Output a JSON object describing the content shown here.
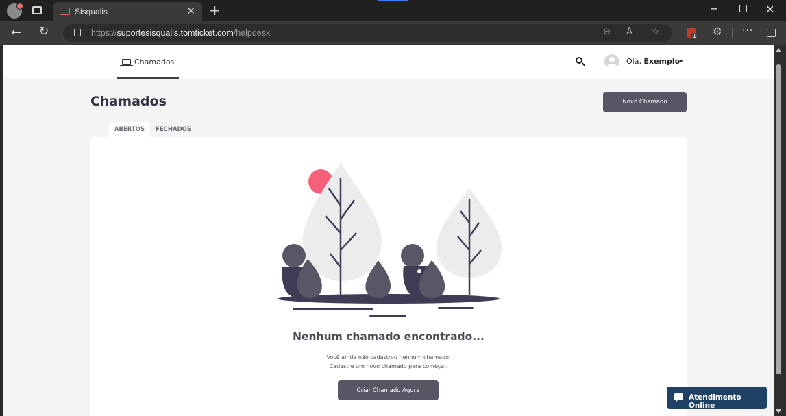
{
  "browser": {
    "tab_title": "Sisqualis",
    "url_prefix": "https://",
    "url_host": "suportesisqualis.tomticket.com",
    "url_path": "/helpdesk",
    "extension_badge_count": "1"
  },
  "header": {
    "nav_tab_label": "Chamados",
    "greeting": "Olá, ",
    "user_name": "Exemplo"
  },
  "page": {
    "title": "Chamados",
    "new_ticket_button": "Novo Chamado",
    "tabs": [
      {
        "label": "ABERTOS",
        "active": true
      },
      {
        "label": "FECHADOS",
        "active": false
      }
    ]
  },
  "empty_state": {
    "title": "Nenhum chamado encontrado...",
    "line1": "Você ainda não cadastrou nenhum chamado.",
    "line2": "Cadastre um novo chamado para começar.",
    "cta": "Criar Chamado Agora"
  },
  "chat": {
    "label": "Atendimento Online"
  },
  "colors": {
    "primary_button": "#585665",
    "chat_button": "#1f4166",
    "sun": "#f7607a"
  }
}
